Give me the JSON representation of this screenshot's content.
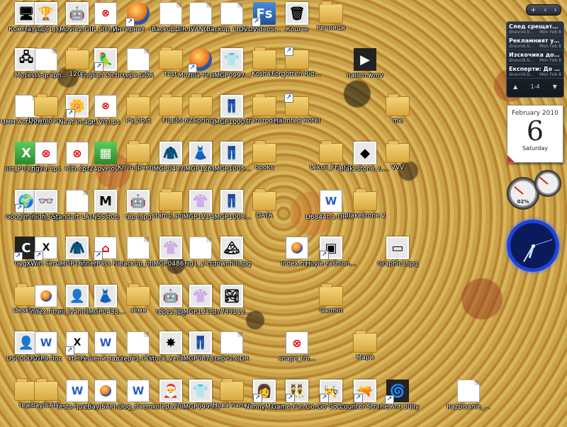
{
  "desktop": {
    "icons": [
      {
        "label": "Компютър",
        "glyph": "🖥",
        "style": "img",
        "shortcut": false
      },
      {
        "label": "fa_cup[1].jpg",
        "glyph": "🏆",
        "style": "img",
        "shortcut": false
      },
      {
        "label": "Movie2.GIF",
        "glyph": "🤖",
        "style": "img",
        "shortcut": false
      },
      {
        "label": "P_S(t).ps",
        "glyph": "⊗",
        "style": "ps",
        "shortcut": false
      },
      {
        "label": "Интернет - Пряк път",
        "glyph": "",
        "style": "ff",
        "shortcut": true
      },
      {
        "label": "Backup_of...",
        "glyph": "",
        "style": "doc",
        "shortcut": false
      },
      {
        "label": "D-R IVANOV_VI...",
        "glyph": "",
        "style": "doc",
        "shortcut": false
      },
      {
        "label": "Backup_of IVANOV_VI...",
        "glyph": "",
        "style": "doc",
        "shortcut": false
      },
      {
        "label": "DVDVideoS... Free Studio",
        "glyph": "Fs",
        "style": "blue",
        "shortcut": true
      },
      {
        "label": "Кошче",
        "glyph": "🗑",
        "style": "img",
        "shortcut": false
      },
      {
        "label": "Речници",
        "glyph": "",
        "style": "folder",
        "shortcut": false
      },
      {
        "label": "Мрежа",
        "glyph": "🖧",
        "style": "img",
        "shortcut": false
      },
      {
        "label": "tests-graph...",
        "glyph": "",
        "style": "doc",
        "shortcut": false
      },
      {
        "label": "1200",
        "glyph": "",
        "style": "folder",
        "shortcut": false
      },
      {
        "label": "English Dictionary",
        "glyph": "🦜",
        "style": "img",
        "shortcut": true
      },
      {
        "label": "tepe.GDR",
        "glyph": "",
        "style": "doc",
        "shortcut": false
      },
      {
        "label": "test",
        "glyph": "",
        "style": "folder",
        "shortcut": false
      },
      {
        "label": "Mozilla Firefox",
        "glyph": "",
        "style": "ff",
        "shortcut": true
      },
      {
        "label": "IMGP0997...",
        "glyph": "👕",
        "style": "img",
        "shortcut": false
      },
      {
        "label": "Koshara",
        "glyph": "",
        "style": "folder",
        "shortcut": false
      },
      {
        "label": "Forgotten Riddles - T...",
        "glyph": "",
        "style": "folder",
        "shortcut": true
      },
      {
        "label": "nailon.wmv",
        "glyph": "▶",
        "style": "dark",
        "shortcut": false
      },
      {
        "label": "UMH Activities...",
        "glyph": "",
        "style": "doc",
        "shortcut": false
      },
      {
        "label": "Downloads",
        "glyph": "",
        "style": "folder",
        "shortcut": false
      },
      {
        "label": "Neat Image",
        "glyph": "🌼",
        "style": "img",
        "shortcut": true
      },
      {
        "label": "P_V(t).ps",
        "glyph": "⊗",
        "style": "ps",
        "shortcut": false
      },
      {
        "label": "PS_obst",
        "glyph": "",
        "style": "folder",
        "shortcut": false
      },
      {
        "label": "FILES",
        "glyph": "",
        "style": "folder",
        "shortcut": false
      },
      {
        "label": "5-6ZSprings...",
        "glyph": "",
        "style": "folder",
        "shortcut": false
      },
      {
        "label": "IMGP1000...",
        "glyph": "👖",
        "style": "img",
        "shortcut": false
      },
      {
        "label": "transrodopi",
        "glyph": "",
        "style": "folder",
        "shortcut": false
      },
      {
        "label": "Haunted Hotel",
        "glyph": "",
        "style": "folder",
        "shortcut": true
      },
      {
        "label": "me",
        "glyph": "",
        "style": "folder",
        "shortcut": false
      },
      {
        "label": "list_PU3_fin...",
        "glyph": "X",
        "style": "green",
        "shortcut": false
      },
      {
        "label": "fig7a.eps",
        "glyph": "⊗",
        "style": "red",
        "shortcut": false
      },
      {
        "label": "P(t).eps",
        "glyph": "⊗",
        "style": "red",
        "shortcut": false
      },
      {
        "label": "f24pvPlov...",
        "glyph": "▦",
        "style": "green",
        "shortcut": false
      },
      {
        "label": "Knvu jpeerat",
        "glyph": "",
        "style": "folder",
        "shortcut": false
      },
      {
        "label": "IMGP0437...",
        "glyph": "🧥",
        "style": "img",
        "shortcut": false
      },
      {
        "label": "IMGP126...",
        "glyph": "👗",
        "style": "img",
        "shortcut": false
      },
      {
        "label": "IMGP1005...",
        "glyph": "👖",
        "style": "img",
        "shortcut": false
      },
      {
        "label": "books",
        "glyph": "",
        "style": "folder",
        "shortcut": false
      },
      {
        "label": "Lekcii_FFI_KH",
        "glyph": "",
        "style": "folder",
        "shortcut": false
      },
      {
        "label": "Blakestone 2.zip",
        "glyph": "◆",
        "style": "img",
        "shortcut": false
      },
      {
        "label": "VVV",
        "glyph": "",
        "style": "folder",
        "shortcut": false
      },
      {
        "label": "Google Earth",
        "glyph": "🌍",
        "style": "img",
        "shortcut": true
      },
      {
        "label": "minidh_logo...",
        "glyph": "👓",
        "style": "img",
        "shortcut": false
      },
      {
        "label": "Standart LATEX.cdr",
        "glyph": "",
        "style": "doc",
        "shortcut": false
      },
      {
        "label": "NSSstub",
        "glyph": "M",
        "style": "img",
        "shortcut": false
      },
      {
        "label": "tepe.jpg",
        "glyph": "🤖",
        "style": "img",
        "shortcut": false
      },
      {
        "label": "stamp_profi",
        "glyph": "",
        "style": "folder",
        "shortcut": false
      },
      {
        "label": "IMGP1214...",
        "glyph": "👚",
        "style": "img",
        "shortcut": false
      },
      {
        "label": "IMGP1008...",
        "glyph": "👖",
        "style": "img",
        "shortcut": false
      },
      {
        "label": "DATA",
        "glyph": "",
        "style": "folder",
        "shortcut": false
      },
      {
        "label": "D6844t-a-UHH.doc",
        "glyph": "W",
        "style": "word",
        "shortcut": false
      },
      {
        "label": "Blakestone 2",
        "glyph": "",
        "style": "folder",
        "shortcut": false
      },
      {
        "label": "Cygwin",
        "glyph": "C",
        "style": "dark",
        "shortcut": true
      },
      {
        "label": "XWin Server",
        "glyph": "X",
        "style": "mono",
        "shortcut": true
      },
      {
        "label": "IMGP1654...",
        "glyph": "🧥",
        "style": "img",
        "shortcut": false
      },
      {
        "label": "InnerPass File Sharing",
        "glyph": "⌂",
        "style": "red",
        "shortcut": true
      },
      {
        "label": "Backup_of...",
        "glyph": "",
        "style": "doc",
        "shortcut": false
      },
      {
        "label": "IMGP0486...",
        "glyph": "👚",
        "style": "img",
        "shortcut": false
      },
      {
        "label": "Fig1_2.cdr",
        "glyph": "",
        "style": "doc",
        "shortcut": false
      },
      {
        "label": "downhill.jpg",
        "glyph": "🏔",
        "style": "img",
        "shortcut": false
      },
      {
        "label": "index.htm",
        "glyph": "",
        "style": "web",
        "shortcut": false
      },
      {
        "label": "Hoyle Fashion Show",
        "glyph": "▣",
        "style": "img",
        "shortcut": true
      },
      {
        "label": "Graphic1.jpg",
        "glyph": "▭",
        "style": "img",
        "shortcut": false
      },
      {
        "label": "Desktop",
        "glyph": "",
        "style": "folder",
        "shortcut": false
      },
      {
        "label": "index.html",
        "glyph": "",
        "style": "web",
        "shortcut": false
      },
      {
        "label": "eli_Ivanich...",
        "glyph": "👤",
        "style": "img",
        "shortcut": false
      },
      {
        "label": "IMGP0433...",
        "glyph": "👗",
        "style": "img",
        "shortcut": false
      },
      {
        "label": "земя",
        "glyph": "",
        "style": "folder",
        "shortcut": false
      },
      {
        "label": "tepe2.jpg",
        "glyph": "🤖",
        "style": "img",
        "shortcut": false
      },
      {
        "label": "IMGP1213...",
        "glyph": "👚",
        "style": "img",
        "shortcut": false
      },
      {
        "label": "d7789112...",
        "glyph": "🏞",
        "style": "img",
        "shortcut": false
      },
      {
        "label": "Garmin",
        "glyph": "",
        "style": "folder",
        "shortcut": false
      },
      {
        "label": "DSC00048...",
        "glyph": "👤",
        "style": "img",
        "shortcut": false
      },
      {
        "label": "P7-P9.doc",
        "glyph": "W",
        "style": "word",
        "shortcut": false
      },
      {
        "label": "xterm",
        "glyph": "X",
        "style": "mono",
        "shortcut": true
      },
      {
        "label": "Решени задачи.doc",
        "glyph": "W",
        "style": "word",
        "shortcut": false
      },
      {
        "label": "tepe1.CDR",
        "glyph": "",
        "style": "doc",
        "shortcut": false
      },
      {
        "label": "stock_vecto...",
        "glyph": "✸",
        "style": "img",
        "shortcut": false
      },
      {
        "label": "IMGP0873...",
        "glyph": "👖",
        "style": "img",
        "shortcut": false
      },
      {
        "label": "tepe2.CDR",
        "glyph": "",
        "style": "doc",
        "shortcut": false
      },
      {
        "label": "snape_fro...",
        "glyph": "⊗",
        "style": "red",
        "shortcut": false
      },
      {
        "label": "Мари",
        "glyph": "",
        "style": "folder",
        "shortcut": false
      },
      {
        "label": "tepe",
        "glyph": "",
        "style": "folder",
        "shortcut": false
      },
      {
        "label": "eBayISAPI...",
        "glyph": "",
        "style": "folder",
        "shortcut": false
      },
      {
        "label": "tests-quest...",
        "glyph": "W",
        "style": "word",
        "shortcut": false
      },
      {
        "label": "eBayISAPI.d...",
        "glyph": "",
        "style": "web",
        "shortcut": false
      },
      {
        "label": "Dog_naem...",
        "glyph": "W",
        "style": "word",
        "shortcut": false
      },
      {
        "label": "koleda2009",
        "glyph": "🎅",
        "style": "img",
        "shortcut": false
      },
      {
        "label": "IMGP0995...",
        "glyph": "👕",
        "style": "img",
        "shortcut": false
      },
      {
        "label": "Нова папка",
        "glyph": "",
        "style": "folder",
        "shortcut": false
      },
      {
        "label": "NannyMania",
        "glyph": "👩",
        "style": "img",
        "shortcut": true
      },
      {
        "label": "Game-Fun... - Пряк път",
        "glyph": "👯",
        "style": "img",
        "shortcut": true
      },
      {
        "label": "Go-Go Gourmet",
        "glyph": "👨‍🍳",
        "style": "img",
        "shortcut": true
      },
      {
        "label": "Counter-Stri... 1.6",
        "glyph": "🔫",
        "style": "img",
        "shortcut": true
      },
      {
        "label": "The Ant Bully",
        "glyph": "🌀",
        "style": "dark",
        "shortcut": true
      },
      {
        "label": "Razpisanie_...",
        "glyph": "",
        "style": "doc",
        "shortcut": false
      }
    ]
  },
  "sidebar": {
    "top_buttons": [
      "+",
      "‹",
      "›"
    ],
    "feeds": {
      "items": [
        {
          "title": "След срещата Бори...",
          "source": "dnevnik.b...",
          "date": "Mon Feb 8"
        },
        {
          "title": "Рекламният удар н...",
          "source": "dnevnik.b...",
          "date": "Mon Feb 8"
        },
        {
          "title": "Изскочика доказат...",
          "source": "dnevnik.b...",
          "date": "Mon Feb 8"
        },
        {
          "title": "Експерти: До 5% е с...",
          "source": "dnevnik.b...",
          "date": "Mon Feb 8"
        }
      ],
      "page": "1-4",
      "prev": "▲",
      "next": "▼"
    },
    "calendar": {
      "month": "February 2010",
      "day": "6",
      "weekday": "Saturday"
    },
    "cpu_gauge": {
      "label": "02%",
      "value": 0.02
    },
    "clock": {
      "hour": 6,
      "minute": 35,
      "second": 12
    }
  }
}
